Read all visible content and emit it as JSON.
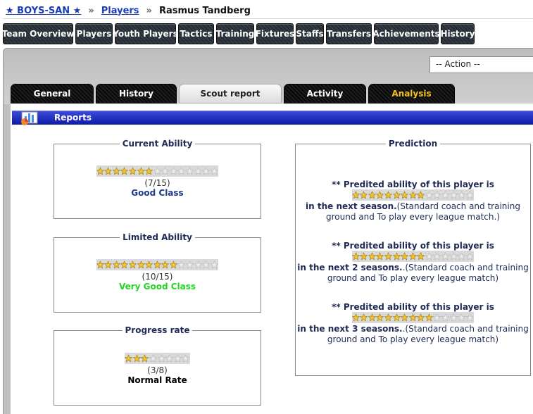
{
  "breadcrumb": {
    "team": "★ BOYS-SAN ★",
    "separator": "»",
    "players": "Players",
    "current": "Rasmus Tandberg"
  },
  "nav": {
    "team_overview": "Team Overview",
    "players": "Players",
    "youth_players": "Youth Players",
    "tactics": "Tactics",
    "training": "Training",
    "fixtures": "Fixtures",
    "staffs": "Staffs",
    "transfers": "Transfers",
    "achievements": "Achievements",
    "history": "History"
  },
  "action_select": {
    "value": "-- Action --"
  },
  "tabs": {
    "general": "General",
    "history": "History",
    "scout_report": "Scout report",
    "activity": "Activity",
    "analysis": "Analysis"
  },
  "reports_title": "Reports",
  "current_ability": {
    "legend": "Current Ability",
    "score": 7,
    "max": 15,
    "score_text": "(7/15)",
    "class": "Good Class",
    "class_color": "#1f3a8a"
  },
  "limited_ability": {
    "legend": "Limited Ability",
    "score": 10,
    "max": 15,
    "score_text": "(10/15)",
    "class": "Very Good Class",
    "class_color": "#22d822"
  },
  "progress_rate": {
    "legend": "Progress rate",
    "score": 3,
    "max": 8,
    "score_text": "(3/8)",
    "class": "Normal Rate",
    "class_color": "#000000"
  },
  "prediction": {
    "legend": "Prediction",
    "items": [
      {
        "heading": "** Predited ability of this player is",
        "score": 9,
        "max": 15,
        "period": "in the next season.",
        "note": "(Standard coach and training ground and To play every league match.)"
      },
      {
        "heading": "** Predited ability of this player is",
        "score": 9,
        "max": 15,
        "period": "in the next 2 seasons.",
        "note": ".(Standard coach and training ground and To play every league match)"
      },
      {
        "heading": "** Predited ability of this player is",
        "score": 10,
        "max": 15,
        "period": "in the next 3 seasons.",
        "note": ".(Standard coach and training ground and To play every league match)"
      }
    ]
  },
  "colors": {
    "star_filled": "#f2c632",
    "star_empty": "#ececec",
    "reports_bar": "#1020b0",
    "link": "#1a3db8",
    "analysis_tab": "#f5c21b"
  }
}
